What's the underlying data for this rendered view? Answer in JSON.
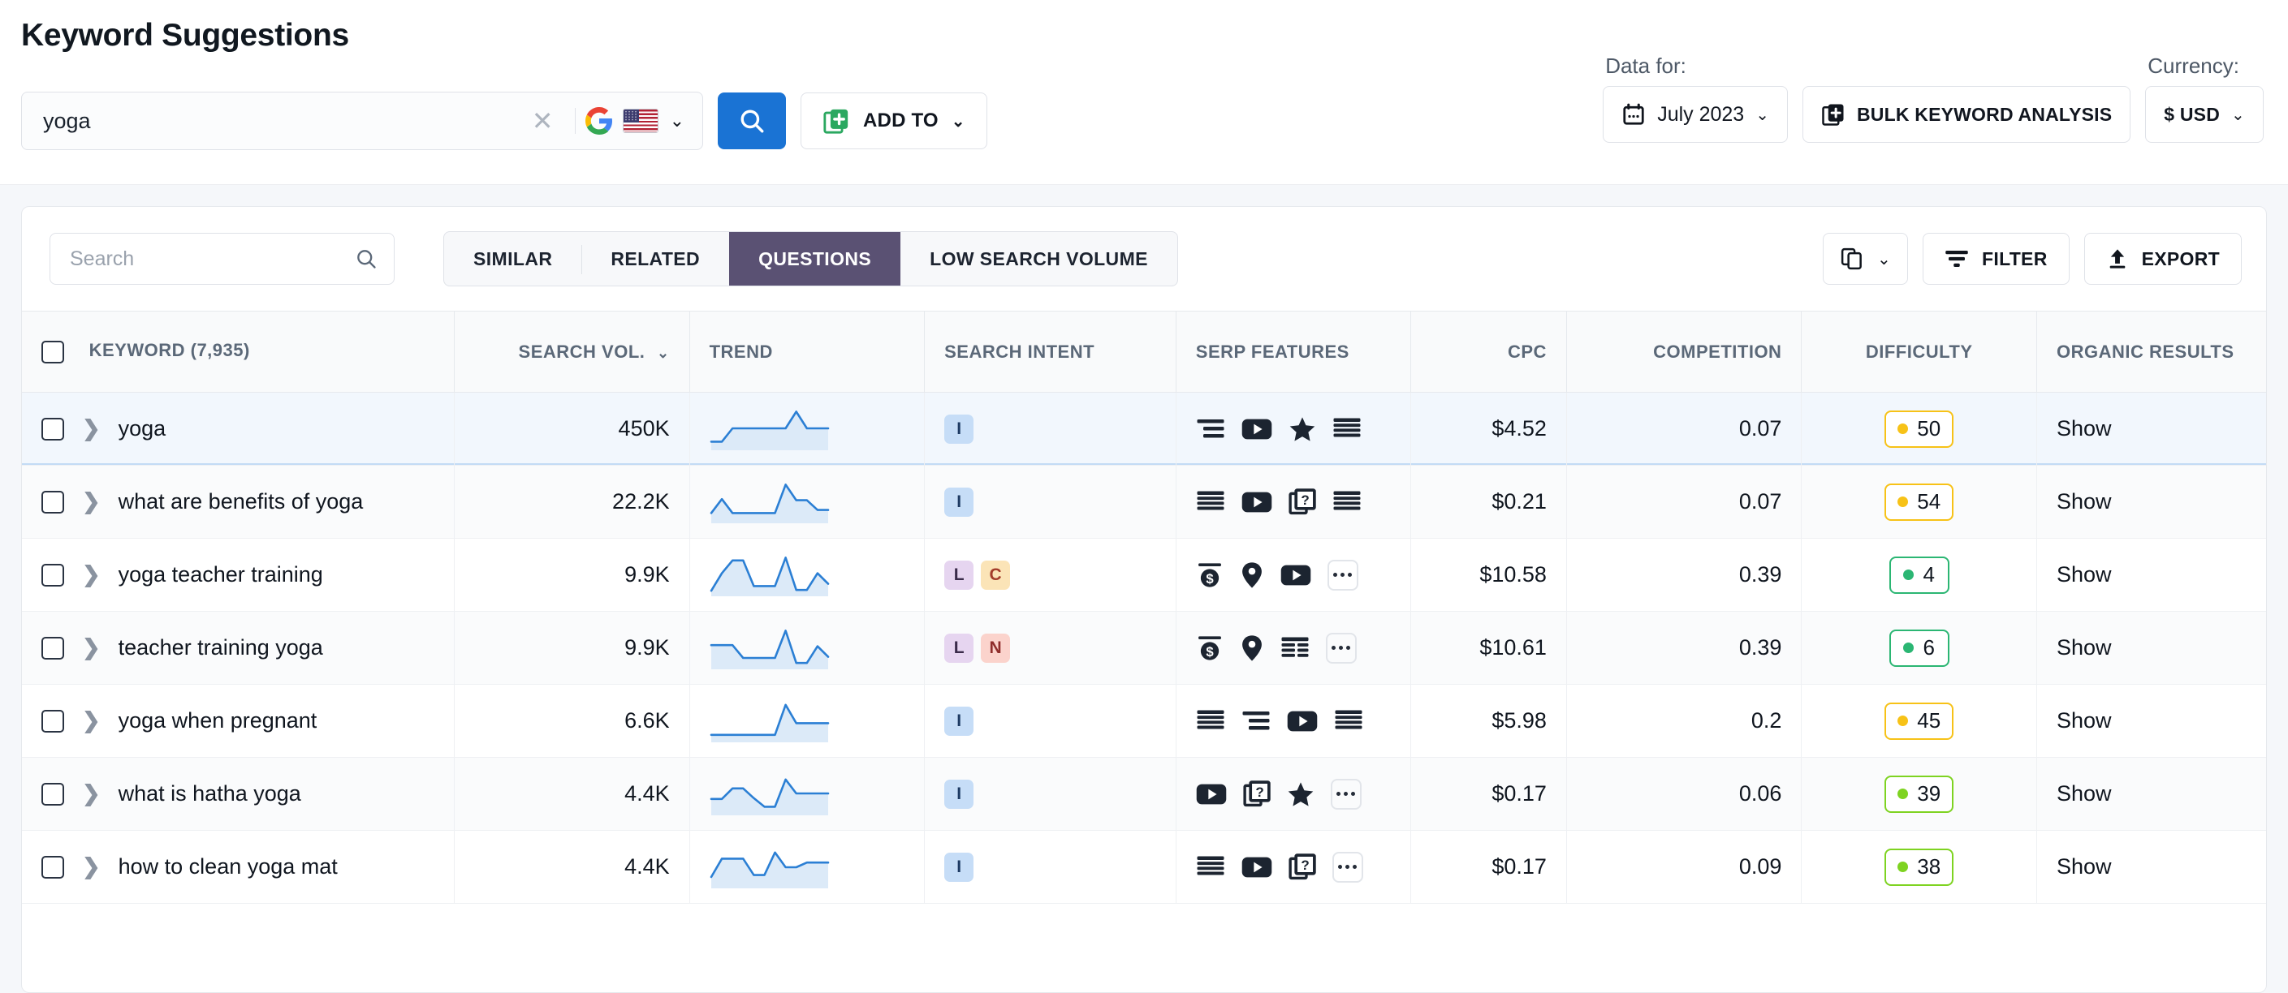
{
  "header": {
    "title": "Keyword Suggestions",
    "search": {
      "value": "yoga",
      "clear_label": "×",
      "engine_icon": "google-icon",
      "country_icon": "us-flag-icon"
    },
    "search_button_label": "",
    "add_to_label": "ADD TO",
    "data_for_label": "Data for:",
    "date_value": "July 2023",
    "bulk_label": "BULK KEYWORD ANALYSIS",
    "currency_label": "Currency:",
    "currency_value": "$ USD"
  },
  "toolbar": {
    "search_placeholder": "Search",
    "search_value": "",
    "tabs": [
      {
        "label": "SIMILAR",
        "active": false
      },
      {
        "label": "RELATED",
        "active": false
      },
      {
        "label": "QUESTIONS",
        "active": true
      },
      {
        "label": "LOW SEARCH VOLUME",
        "active": false
      }
    ],
    "filter_label": "FILTER",
    "export_label": "EXPORT",
    "columns_label": ""
  },
  "table": {
    "columns": [
      "KEYWORD  (7,935)",
      "SEARCH VOL.",
      "TREND",
      "SEARCH INTENT",
      "SERP FEATURES",
      "CPC",
      "COMPETITION",
      "DIFFICULTY",
      "ORGANIC RESULTS"
    ],
    "keyword_count": "(7,935)",
    "rows": [
      {
        "keyword": "yoga",
        "volume": "450K",
        "trend": [
          18,
          18,
          52,
          52,
          52,
          52,
          52,
          52,
          95,
          52,
          52,
          52
        ],
        "intent": [
          "I"
        ],
        "serp": [
          "featured-snippet-icon",
          "video-icon",
          "reviews-icon",
          "local-pack-icon"
        ],
        "cpc": "$4.52",
        "competition": "0.07",
        "difficulty": "50",
        "difficulty_color": "yellow",
        "organic": "Show",
        "highlight": true
      },
      {
        "keyword": "what are benefits of yoga",
        "volume": "22.2K",
        "trend": [
          22,
          58,
          22,
          22,
          22,
          22,
          22,
          95,
          55,
          55,
          30,
          30
        ],
        "intent": [
          "I"
        ],
        "serp": [
          "local-pack-icon",
          "video-icon",
          "people-also-ask-icon",
          "local-pack-icon"
        ],
        "cpc": "$0.21",
        "competition": "0.07",
        "difficulty": "54",
        "difficulty_color": "yellow",
        "organic": "Show",
        "highlight": false
      },
      {
        "keyword": "yoga teacher training",
        "volume": "9.9K",
        "trend": [
          10,
          55,
          88,
          88,
          22,
          22,
          22,
          95,
          12,
          12,
          55,
          28
        ],
        "intent": [
          "L",
          "C"
        ],
        "serp": [
          "ads-icon",
          "map-pin-icon",
          "video-icon",
          "more-icon"
        ],
        "cpc": "$10.58",
        "competition": "0.39",
        "difficulty": "4",
        "difficulty_color": "green",
        "organic": "Show",
        "highlight": false
      },
      {
        "keyword": "teacher training yoga",
        "volume": "9.9K",
        "trend": [
          58,
          58,
          58,
          25,
          25,
          25,
          25,
          95,
          12,
          12,
          55,
          28
        ],
        "intent": [
          "L",
          "N"
        ],
        "serp": [
          "ads-icon",
          "map-pin-icon",
          "table-icon",
          "more-icon"
        ],
        "cpc": "$10.61",
        "competition": "0.39",
        "difficulty": "6",
        "difficulty_color": "green",
        "organic": "Show",
        "highlight": false
      },
      {
        "keyword": "yoga when pregnant",
        "volume": "6.6K",
        "trend": [
          15,
          15,
          15,
          15,
          15,
          15,
          15,
          92,
          45,
          45,
          45,
          45
        ],
        "intent": [
          "I"
        ],
        "serp": [
          "local-pack-icon",
          "featured-snippet-icon",
          "video-icon",
          "local-pack-icon"
        ],
        "cpc": "$5.98",
        "competition": "0.2",
        "difficulty": "45",
        "difficulty_color": "yellow",
        "organic": "Show",
        "highlight": false
      },
      {
        "keyword": "what is hatha yoga",
        "volume": "4.4K",
        "trend": [
          38,
          38,
          65,
          65,
          40,
          18,
          18,
          88,
          52,
          52,
          52,
          52
        ],
        "intent": [
          "I"
        ],
        "serp": [
          "video-icon",
          "people-also-ask-icon",
          "reviews-icon",
          "more-icon"
        ],
        "cpc": "$0.17",
        "competition": "0.06",
        "difficulty": "39",
        "difficulty_color": "lime",
        "organic": "Show",
        "highlight": false
      },
      {
        "keyword": "how to clean yoga mat",
        "volume": "4.4K",
        "trend": [
          25,
          72,
          72,
          72,
          30,
          30,
          88,
          50,
          50,
          62,
          62,
          62
        ],
        "intent": [
          "I"
        ],
        "serp": [
          "local-pack-icon",
          "video-icon",
          "people-also-ask-icon",
          "more-icon"
        ],
        "cpc": "$0.17",
        "competition": "0.09",
        "difficulty": "38",
        "difficulty_color": "lime",
        "organic": "Show",
        "highlight": false
      }
    ]
  },
  "colors": {
    "accent_blue": "#1a73d4",
    "tab_active": "#5a5173",
    "spark_line": "#2b7fd4",
    "highlight_row": "#f2f7fd",
    "difficulty_yellow": "#f7c217",
    "difficulty_green": "#2bb673",
    "difficulty_lime": "#7ed321"
  }
}
